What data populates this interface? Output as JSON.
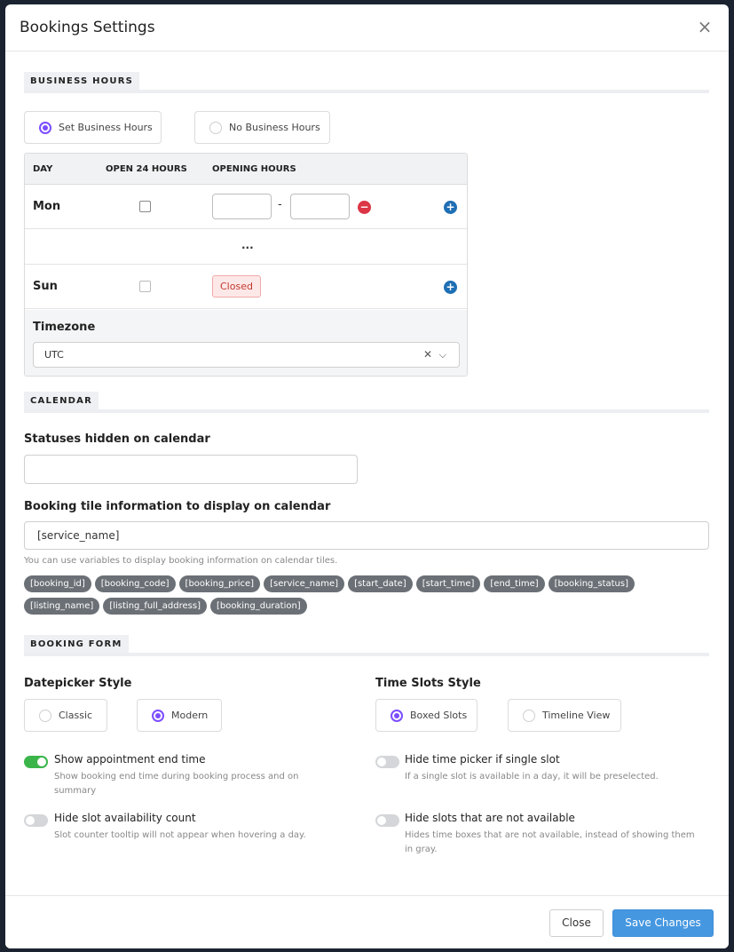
{
  "modal": {
    "title": "Bookings Settings",
    "close_symbol": "×"
  },
  "business_hours": {
    "section_title": "BUSINESS HOURS",
    "options": [
      {
        "label": "Set Business Hours",
        "selected": true
      },
      {
        "label": "No Business Hours",
        "selected": false
      }
    ],
    "table": {
      "headers": {
        "day": "DAY",
        "open24": "OPEN 24 HOURS",
        "opening": "OPENING HOURS"
      },
      "rows": {
        "mon": {
          "day": "Mon",
          "open_from": "",
          "open_to": "",
          "dash": "-"
        },
        "ellipsis": "...",
        "sun": {
          "day": "Sun",
          "status": "Closed"
        }
      }
    },
    "timezone": {
      "label": "Timezone",
      "value": "UTC"
    }
  },
  "calendar": {
    "section_title": "CALENDAR",
    "statuses_label": "Statuses hidden on calendar",
    "statuses_value": "",
    "tile_label": "Booking tile information to display on calendar",
    "tile_value": "[service_name]",
    "help": "You can use variables to display booking information on calendar tiles.",
    "variables": [
      "[booking_id]",
      "[booking_code]",
      "[booking_price]",
      "[service_name]",
      "[start_date]",
      "[start_time]",
      "[end_time]",
      "[booking_status]",
      "[listing_name]",
      "[listing_full_address]",
      "[booking_duration]"
    ]
  },
  "booking_form": {
    "section_title": "BOOKING FORM",
    "datepicker": {
      "label": "Datepicker Style",
      "options": [
        {
          "label": "Classic",
          "selected": false
        },
        {
          "label": "Modern",
          "selected": true
        }
      ]
    },
    "timeslots": {
      "label": "Time Slots Style",
      "options": [
        {
          "label": "Boxed Slots",
          "selected": true
        },
        {
          "label": "Timeline View",
          "selected": false
        }
      ]
    },
    "toggles": [
      {
        "title": "Show appointment end time",
        "desc": "Show booking end time during booking process and on summary",
        "on": true
      },
      {
        "title": "Hide time picker if single slot",
        "desc": "If a single slot is available in a day, it will be preselected.",
        "on": false
      },
      {
        "title": "Hide slot availability count",
        "desc": "Slot counter tooltip will not appear when hovering a day.",
        "on": false
      },
      {
        "title": "Hide slots that are not available",
        "desc": "Hides time boxes that are not available, instead of showing them in gray.",
        "on": false
      }
    ]
  },
  "footer": {
    "close_label": "Close",
    "save_label": "Save Changes"
  },
  "colors": {
    "accent_radio": "#7c4dff",
    "toggle_on": "#3bb54a",
    "primary_button": "#4597e0",
    "chip_bg": "#6b7076",
    "remove_icon": "#dc3545",
    "add_icon": "#1f6fb5"
  }
}
